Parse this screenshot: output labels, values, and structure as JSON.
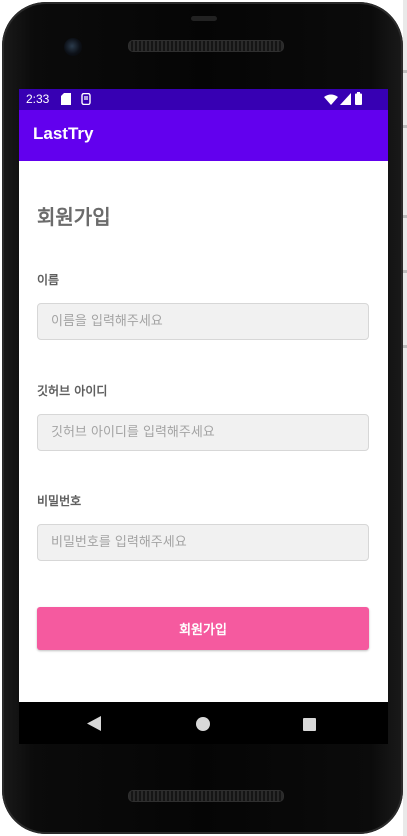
{
  "status_bar": {
    "time": "2:33",
    "left_icons": [
      "sd-card-icon",
      "notification-icon"
    ],
    "right_icons": [
      "wifi-icon",
      "cellular-signal-icon",
      "battery-icon"
    ]
  },
  "app_bar": {
    "title": "LastTry"
  },
  "form": {
    "title": "회원가입",
    "fields": [
      {
        "label": "이름",
        "placeholder": "이름을 입력해주세요",
        "value": ""
      },
      {
        "label": "깃허브 아이디",
        "placeholder": "깃허브 아이디를 입력해주세요",
        "value": ""
      },
      {
        "label": "비밀번호",
        "placeholder": "비밀번호를 입력해주세요",
        "value": ""
      }
    ],
    "submit_label": "회원가입"
  },
  "nav_bar": {
    "buttons": [
      "back-icon",
      "home-icon",
      "recents-icon"
    ]
  },
  "colors": {
    "status_bar": "#3700b3",
    "app_bar": "#6200ee",
    "button": "#f55a9f",
    "input_bg": "#f1f1f1"
  }
}
